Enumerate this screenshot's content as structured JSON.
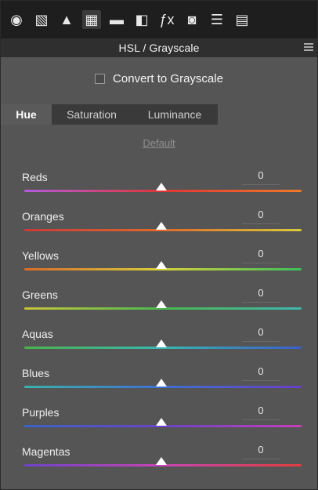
{
  "toolbar": {
    "tools": [
      {
        "icon": "basic-panel-icon",
        "glyph": "◉"
      },
      {
        "icon": "tone-curve-icon",
        "glyph": "▧"
      },
      {
        "icon": "detail-icon",
        "glyph": "▲"
      },
      {
        "icon": "hsl-icon",
        "glyph": "▦"
      },
      {
        "icon": "split-toning-icon",
        "glyph": "▬"
      },
      {
        "icon": "lens-corrections-icon",
        "glyph": "◧"
      },
      {
        "icon": "effects-icon",
        "glyph": "ƒx"
      },
      {
        "icon": "camera-calibration-icon",
        "glyph": "◙"
      },
      {
        "icon": "presets-icon",
        "glyph": "☰"
      },
      {
        "icon": "snapshots-icon",
        "glyph": "▤"
      }
    ]
  },
  "panel": {
    "title": "HSL / Grayscale",
    "grayscale_label": "Convert to Grayscale",
    "tabs": [
      "Hue",
      "Saturation",
      "Luminance"
    ],
    "default_link": "Default"
  },
  "sliders": [
    {
      "label": "Reds",
      "value": "0",
      "colors": [
        "#b45adc",
        "#e03535",
        "#f07a28"
      ]
    },
    {
      "label": "Oranges",
      "value": "0",
      "colors": [
        "#c93a3a",
        "#e06a2a",
        "#d8cc3a"
      ]
    },
    {
      "label": "Yellows",
      "value": "0",
      "colors": [
        "#d96a2a",
        "#d6d23a",
        "#3bbf5a"
      ]
    },
    {
      "label": "Greens",
      "value": "0",
      "colors": [
        "#c8c43a",
        "#49b94f",
        "#3fb7ad"
      ]
    },
    {
      "label": "Aquas",
      "value": "0",
      "colors": [
        "#4cb24e",
        "#3ab6b0",
        "#3a5ec8"
      ]
    },
    {
      "label": "Blues",
      "value": "0",
      "colors": [
        "#3ab3ad",
        "#3d6fd0",
        "#6a3fc9"
      ]
    },
    {
      "label": "Purples",
      "value": "0",
      "colors": [
        "#3a63c7",
        "#6b43c8",
        "#c63fb8"
      ]
    },
    {
      "label": "Magentas",
      "value": "0",
      "colors": [
        "#6c44c9",
        "#c845b3",
        "#e23d3d"
      ]
    }
  ]
}
